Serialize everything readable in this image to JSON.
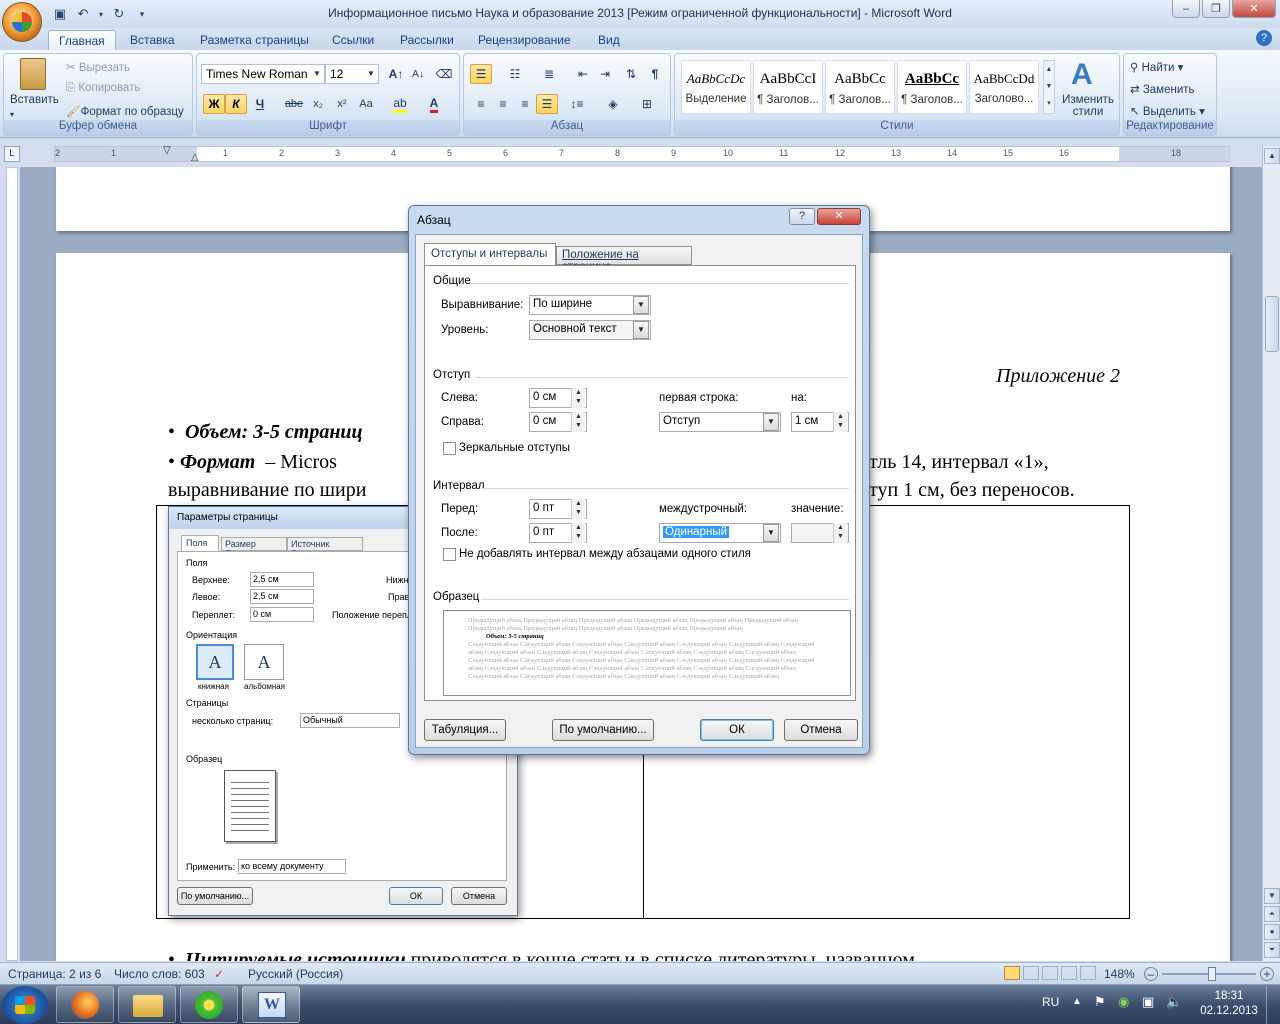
{
  "window": {
    "title": "Информационное письмо Наука и образование 2013 [Режим ограниченной функциональности]  -  Microsoft Word"
  },
  "tabs": [
    "Главная",
    "Вставка",
    "Разметка страницы",
    "Ссылки",
    "Рассылки",
    "Рецензирование",
    "Вид"
  ],
  "ribbon": {
    "clipboard": {
      "label": "Буфер обмена",
      "paste": "Вставить",
      "cut": "Вырезать",
      "copy": "Копировать",
      "format_painter": "Формат по образцу"
    },
    "font": {
      "label": "Шрифт",
      "family": "Times New Roman",
      "size": "12",
      "bold": "Ж",
      "italic": "К",
      "underline": "Ч",
      "strike": "abe",
      "sub": "x₂",
      "sup": "x²",
      "case": "Aa",
      "grow": "A",
      "shrink": "A"
    },
    "paragraph": {
      "label": "Абзац",
      "pilcrow": "¶"
    },
    "styles": {
      "label": "Стили",
      "items": [
        {
          "sample": "AaBbCcDc",
          "name": "Выделение"
        },
        {
          "sample": "AaBbCcI",
          "name": "¶ Заголов..."
        },
        {
          "sample": "AaBbCc",
          "name": "¶ Заголов..."
        },
        {
          "sample": "AaBbCc",
          "name": "¶ Заголов..."
        },
        {
          "sample": "AaBbCcDd",
          "name": "Заголово..."
        }
      ],
      "change_styles": "Изменить стили"
    },
    "editing": {
      "label": "Редактирование",
      "find": "Найти",
      "replace": "Заменить",
      "select": "Выделить"
    }
  },
  "ruler": {
    "numbers": [
      "2",
      "1",
      "1",
      "1",
      "2",
      "3",
      "4",
      "5",
      "6",
      "7",
      "8",
      "9",
      "10",
      "11",
      "12",
      "13",
      "14",
      "15",
      "16",
      "18"
    ]
  },
  "document": {
    "appendix": "Приложение 2",
    "bullet1_label": "Объем: 3-5 страниц",
    "bullet2_label": "Формат",
    "bullet2_rest_a": "–  Micros",
    "bullet2_rest_b": "тль  14,  интервал  «1»,",
    "line2_a": "выравнивание по шири",
    "line2_b": "туп 1 см, без переносов.",
    "bottom_line_a": "Цитируемые источники",
    "bottom_line_b": "приводятся  в  конце  статьи  в  списке  литературы,  названном"
  },
  "page_setup_dialog": {
    "title": "Параметры страницы",
    "tabs": [
      "Поля",
      "Размер бумаги",
      "Источник бумаги"
    ],
    "margins_section": "Поля",
    "top_label": "Верхнее:",
    "top_value": "2,5 см",
    "left_label": "Левое:",
    "left_value": "2,5 см",
    "gutter_label": "Переплет:",
    "gutter_value": "0 см",
    "bottom_label_partial": "Нижн",
    "right_label_partial": "Прав",
    "gutter_pos_partial": "Положение переплет",
    "orientation_section": "Ориентация",
    "portrait": "книжная",
    "landscape": "альбомная",
    "pages_section": "Страницы",
    "multiple_pages_label": "несколько страниц:",
    "multiple_pages_value": "Обычный",
    "sample_section": "Образец",
    "apply_label": "Применить:",
    "apply_value": "ко всему документу",
    "default_btn": "По умолчанию...",
    "ok_btn": "ОК",
    "cancel_btn": "Отмена"
  },
  "paragraph_dialog": {
    "title": "Абзац",
    "tabs": [
      "Отступы и интервалы",
      "Положение на странице"
    ],
    "general_section": "Общие",
    "alignment_label": "Выравнивание:",
    "alignment_value": "По ширине",
    "level_label": "Уровень:",
    "level_value": "Основной текст",
    "indent_section": "Отступ",
    "left_label": "Слева:",
    "left_value": "0 см",
    "right_label": "Справа:",
    "right_value": "0 см",
    "first_line_label": "первая строка:",
    "first_line_value": "Отступ",
    "by_label": "на:",
    "by_value": "1 см",
    "mirror_label": "Зеркальные отступы",
    "spacing_section": "Интервал",
    "before_label": "Перед:",
    "before_value": "0 пт",
    "after_label": "После:",
    "after_value": "0 пт",
    "line_spacing_label": "междустрочный:",
    "line_spacing_value": "Одинарный",
    "at_label": "значение:",
    "at_value": "",
    "no_space_label": "Не добавлять интервал между абзацами одного стиля",
    "preview_section": "Образец",
    "preview_prev": "Предыдущий абзац Предыдущий абзац Предыдущий абзац Предыдущий абзац Предыдущий абзац Предыдущий абзац Предыдущий абзац Предыдущий абзац Предыдущий абзац Предыдущий абзац Предыдущий абзац",
    "preview_current": "Объем: 3-5 страниц",
    "preview_next": "Следующий абзац Следующий абзац Следующий абзац Следующий абзац Следующий абзац Следующий абзац Следующий абзац Следующий абзац Следующий абзац Следующий абзац Следующий абзац Следующий абзац Следующий абзац Следующий абзац Следующий абзац Следующий абзац Следующий абзац Следующий абзац Следующий абзац Следующий абзац Следующий абзац Следующий абзац Следующий абзац Следующий абзац Следующий абзац Следующий абзац Следующий абзац Следующий абзац Следующий абзац Следующий абзац Следующий абзац Следующий абзац",
    "tabs_btn": "Табуляция...",
    "default_btn": "По умолчанию...",
    "ok_btn": "ОК",
    "cancel_btn": "Отмена"
  },
  "statusbar": {
    "page": "Страница: 2 из 6",
    "words": "Число слов: 603",
    "language": "Русский (Россия)",
    "zoom": "148%"
  },
  "taskbar": {
    "lang": "RU",
    "time": "18:31",
    "date": "02.12.2013"
  }
}
